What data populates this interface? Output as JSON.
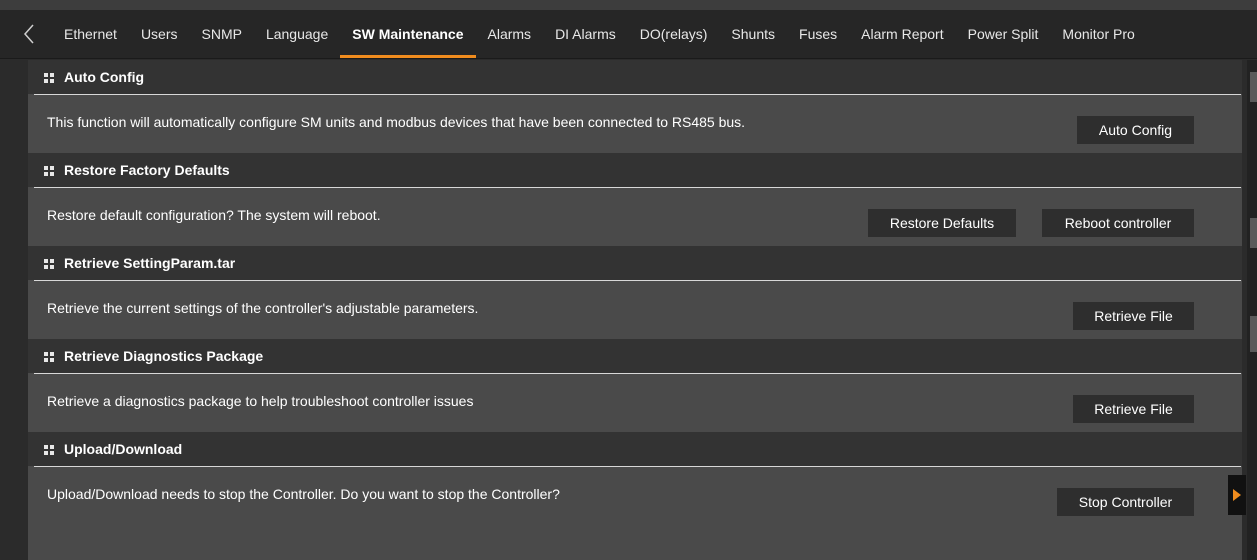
{
  "tabs": [
    {
      "label": "Ethernet",
      "active": false
    },
    {
      "label": "Users",
      "active": false
    },
    {
      "label": "SNMP",
      "active": false
    },
    {
      "label": "Language",
      "active": false
    },
    {
      "label": "SW Maintenance",
      "active": true
    },
    {
      "label": "Alarms",
      "active": false
    },
    {
      "label": "DI Alarms",
      "active": false
    },
    {
      "label": "DO(relays)",
      "active": false
    },
    {
      "label": "Shunts",
      "active": false
    },
    {
      "label": "Fuses",
      "active": false
    },
    {
      "label": "Alarm Report",
      "active": false
    },
    {
      "label": "Power Split",
      "active": false
    },
    {
      "label": "Monitor Pro",
      "active": false
    }
  ],
  "sections": {
    "auto_config": {
      "title": "Auto Config",
      "text": "This function will automatically configure SM units and modbus devices that have been connected to RS485 bus.",
      "button": "Auto Config"
    },
    "restore_defaults": {
      "title": "Restore Factory Defaults",
      "text": "Restore default configuration? The system will reboot.",
      "button_restore": "Restore Defaults",
      "button_reboot": "Reboot controller"
    },
    "retrieve_settings": {
      "title": "Retrieve SettingParam.tar",
      "text": "Retrieve the current settings of the controller's adjustable parameters.",
      "button": "Retrieve File"
    },
    "retrieve_diagnostics": {
      "title": "Retrieve Diagnostics Package",
      "text": "Retrieve a diagnostics package to help troubleshoot controller issues",
      "button": "Retrieve File"
    },
    "upload_download": {
      "title": "Upload/Download",
      "text": "Upload/Download needs to stop the Controller. Do you want to stop the Controller?",
      "button": "Stop Controller"
    }
  },
  "colors": {
    "accent": "#f08c1e",
    "panel": "#4a4a4a",
    "header": "#333333",
    "button": "#2e2e2e"
  },
  "icons": {
    "back": "chevron-left-icon",
    "section": "grip-icon",
    "rail": "triangle-right-icon"
  }
}
